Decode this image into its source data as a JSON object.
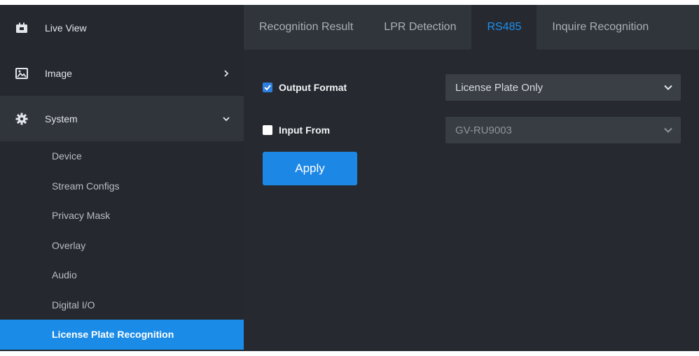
{
  "sidebar": {
    "items": [
      {
        "label": "Live View",
        "icon": "video-camera-icon"
      },
      {
        "label": "Image",
        "icon": "image-icon",
        "chevron": "chevron-right-icon"
      },
      {
        "label": "System",
        "icon": "gear-icon",
        "chevron": "chevron-down-icon"
      }
    ],
    "sub_items": [
      {
        "label": "Device"
      },
      {
        "label": "Stream Configs"
      },
      {
        "label": "Privacy Mask"
      },
      {
        "label": "Overlay"
      },
      {
        "label": "Audio"
      },
      {
        "label": "Digital I/O"
      },
      {
        "label": "License Plate Recognition",
        "active": true
      }
    ]
  },
  "tabs": [
    {
      "label": "Recognition Result"
    },
    {
      "label": "LPR Detection"
    },
    {
      "label": "RS485",
      "active": true
    },
    {
      "label": "Inquire Recognition"
    }
  ],
  "form": {
    "output_format": {
      "label": "Output Format",
      "checked": true,
      "value": "License Plate Only"
    },
    "input_from": {
      "label": "Input From",
      "checked": false,
      "value": "GV-RU9003"
    },
    "apply_label": "Apply"
  },
  "colors": {
    "accent": "#1a8be6",
    "active_tab_text": "#1e8fef",
    "sidebar_bg": "#25292f",
    "main_bg": "#262a30",
    "tabbar_bg": "#30343b"
  }
}
